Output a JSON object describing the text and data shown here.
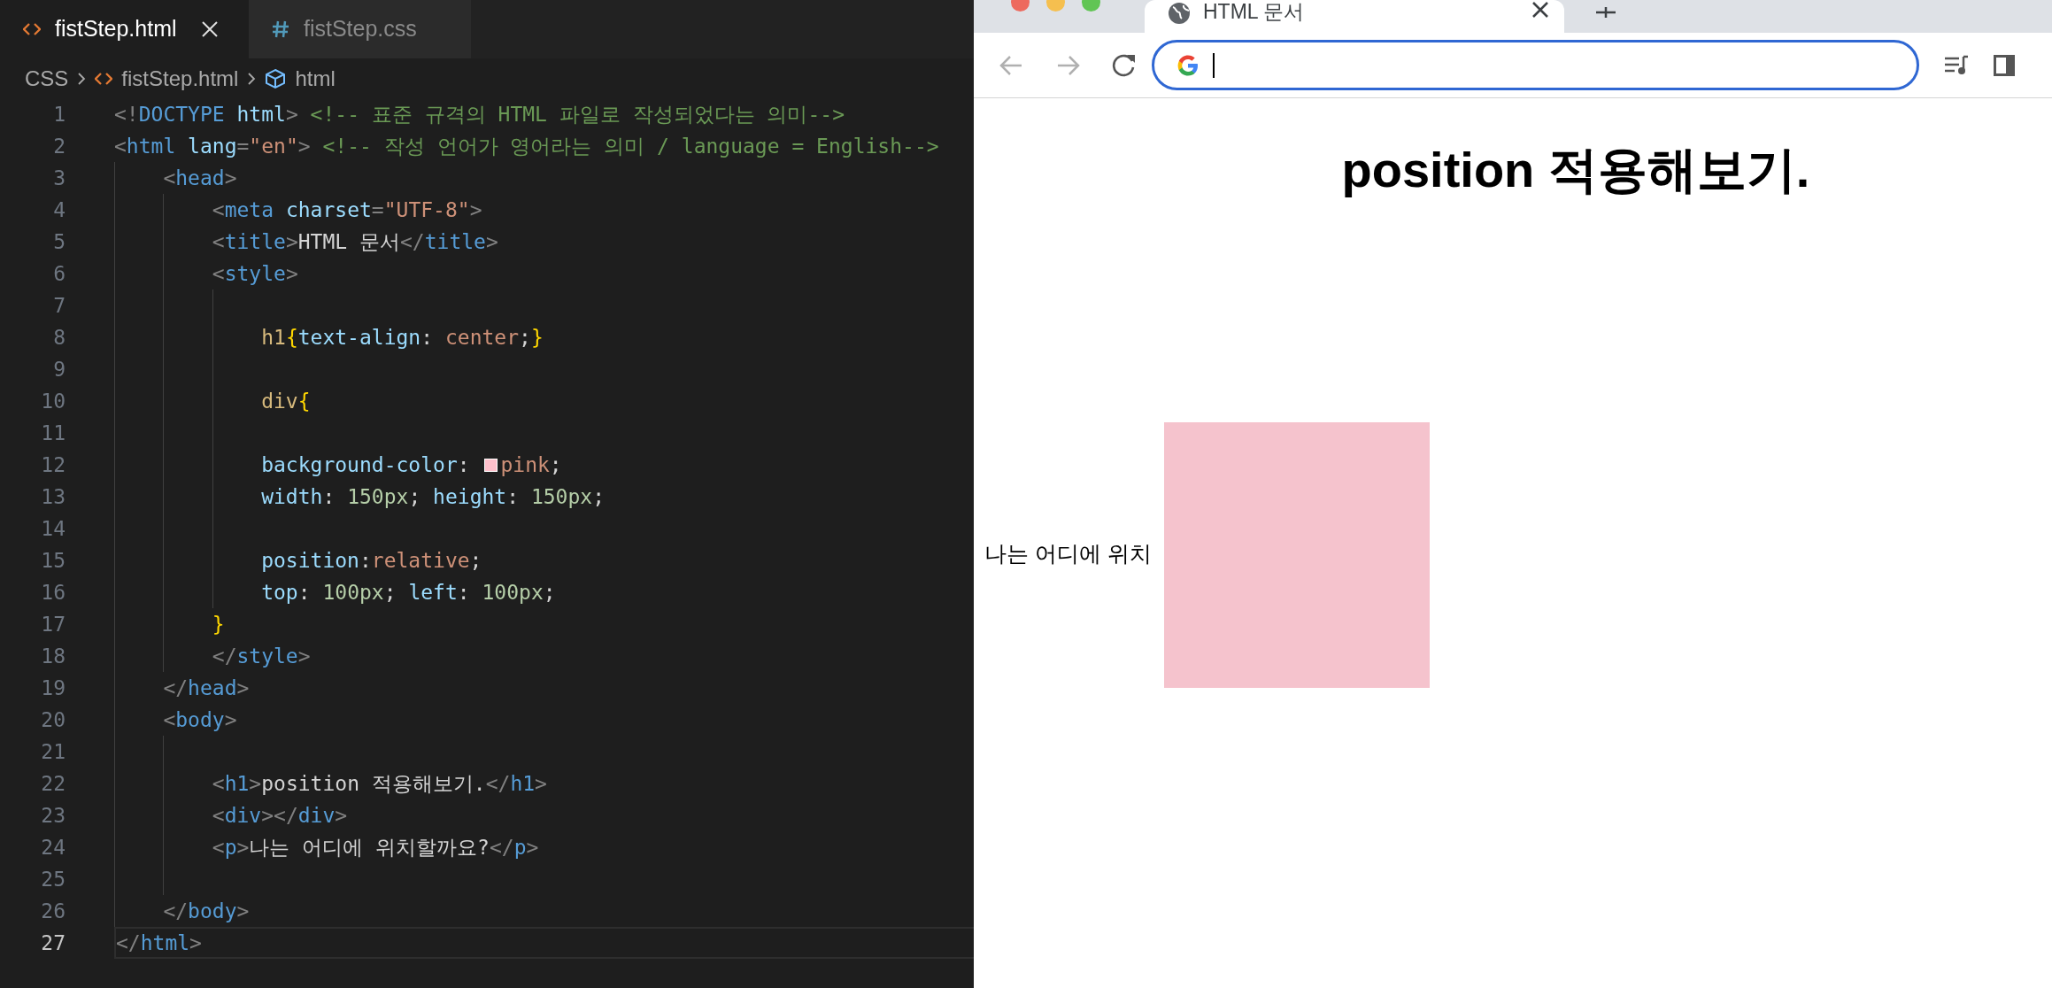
{
  "editor": {
    "tabs": [
      {
        "label": "fistStep.html",
        "kind": "html",
        "selected": true
      },
      {
        "label": "fistStep.css",
        "kind": "css",
        "selected": false
      }
    ],
    "breadcrumb": [
      {
        "label": "CSS",
        "kind": "folder"
      },
      {
        "label": "fistStep.html",
        "kind": "file"
      },
      {
        "label": "html",
        "kind": "symbol"
      }
    ],
    "lines": [
      {
        "n": "1",
        "current": false,
        "text": "<!DOCTYPE html> <!-- 표준 규격의 HTML 파일로 작성되었다는 의미-->"
      },
      {
        "n": "2",
        "current": false,
        "text": "<html lang=\"en\"> <!-- 작성 언어가 영어라는 의미 / language = English-->"
      },
      {
        "n": "3",
        "current": false,
        "text": "    <head>"
      },
      {
        "n": "4",
        "current": false,
        "text": "        <meta charset=\"UTF-8\">"
      },
      {
        "n": "5",
        "current": false,
        "text": "        <title>HTML 문서</title>"
      },
      {
        "n": "6",
        "current": false,
        "text": "        <style>"
      },
      {
        "n": "7",
        "current": false
      },
      {
        "n": "8",
        "current": false,
        "text": "            h1{text-align: center;}"
      },
      {
        "n": "9",
        "current": false
      },
      {
        "n": "10",
        "current": false,
        "text": "            div{"
      },
      {
        "n": "11",
        "current": false
      },
      {
        "n": "12",
        "current": false,
        "text": "            background-color: pink;",
        "color": "#ffc0cb"
      },
      {
        "n": "13",
        "current": false,
        "text": "            width: 150px; height: 150px;"
      },
      {
        "n": "14",
        "current": false
      },
      {
        "n": "15",
        "current": false,
        "text": "            position:relative;"
      },
      {
        "n": "16",
        "current": false,
        "text": "            top: 100px; left: 100px;"
      },
      {
        "n": "17",
        "current": false,
        "text": "        }"
      },
      {
        "n": "18",
        "current": false,
        "text": "        </style>"
      },
      {
        "n": "19",
        "current": false,
        "text": "    </head>"
      },
      {
        "n": "20",
        "current": false,
        "text": "    <body>"
      },
      {
        "n": "21",
        "current": false
      },
      {
        "n": "22",
        "current": false,
        "text": "        <h1>position 적용해보기.</h1>"
      },
      {
        "n": "23",
        "current": false,
        "text": "        <div></div>"
      },
      {
        "n": "24",
        "current": false,
        "text": "        <p>나는 어디에 위치할까요?</p>"
      },
      {
        "n": "25",
        "current": false
      },
      {
        "n": "26",
        "current": false,
        "text": "    </body>"
      },
      {
        "n": "27",
        "current": true,
        "text": "</html>"
      }
    ]
  },
  "browser": {
    "tab": {
      "title": "HTML 문서",
      "selected": true
    },
    "omnibox": {
      "focused": true
    },
    "page": {
      "heading": "position 적용해보기.",
      "paragraph": "나는 어디에 위치"
    }
  }
}
